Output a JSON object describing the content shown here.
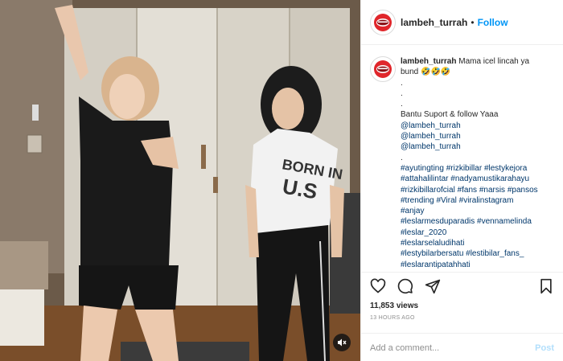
{
  "post": {
    "username": "lambeh_turrah",
    "follow_label": "Follow",
    "separator": "•"
  },
  "caption": {
    "username": "lambeh_turrah",
    "first_line": "Mama icel lincah ya",
    "second_line": "bund 🤣🤣🤣",
    "lines": [
      ".",
      ".",
      ".",
      "Bantu Suport & follow Yaaa",
      "@lambeh_turrah",
      "@lambeh_turrah",
      "@lambeh_turrah",
      ".",
      "#ayutingting #rizkibillar #lestykejora",
      "#attahalilintar #nadyamustikarahayu",
      "#rizkibillarofcial #fans #narsis #pansos",
      "#trending #Viral #viralinstagram",
      "#anjay",
      "#leslarmesduparadis #vennamelinda",
      "#leslar_2020",
      "#leslarselaludihati",
      "#lestybilarbersatu #lestibilar_fans_",
      "#leslarantipatahhati"
    ]
  },
  "icons": {
    "like": "heart-icon",
    "comment": "comment-icon",
    "share": "share-icon",
    "save": "bookmark-icon",
    "mute": "muted-speaker-icon",
    "avatar": "lips-logo-icon"
  },
  "stats": {
    "views": "11,853 views",
    "time": "13 HOURS AGO"
  },
  "comment": {
    "placeholder": "Add a comment...",
    "post_label": "Post"
  },
  "colors": {
    "accent": "#0095f6",
    "hashtag": "#00376b",
    "post_disabled": "#b2dffc",
    "logo_red": "#e0262b"
  }
}
